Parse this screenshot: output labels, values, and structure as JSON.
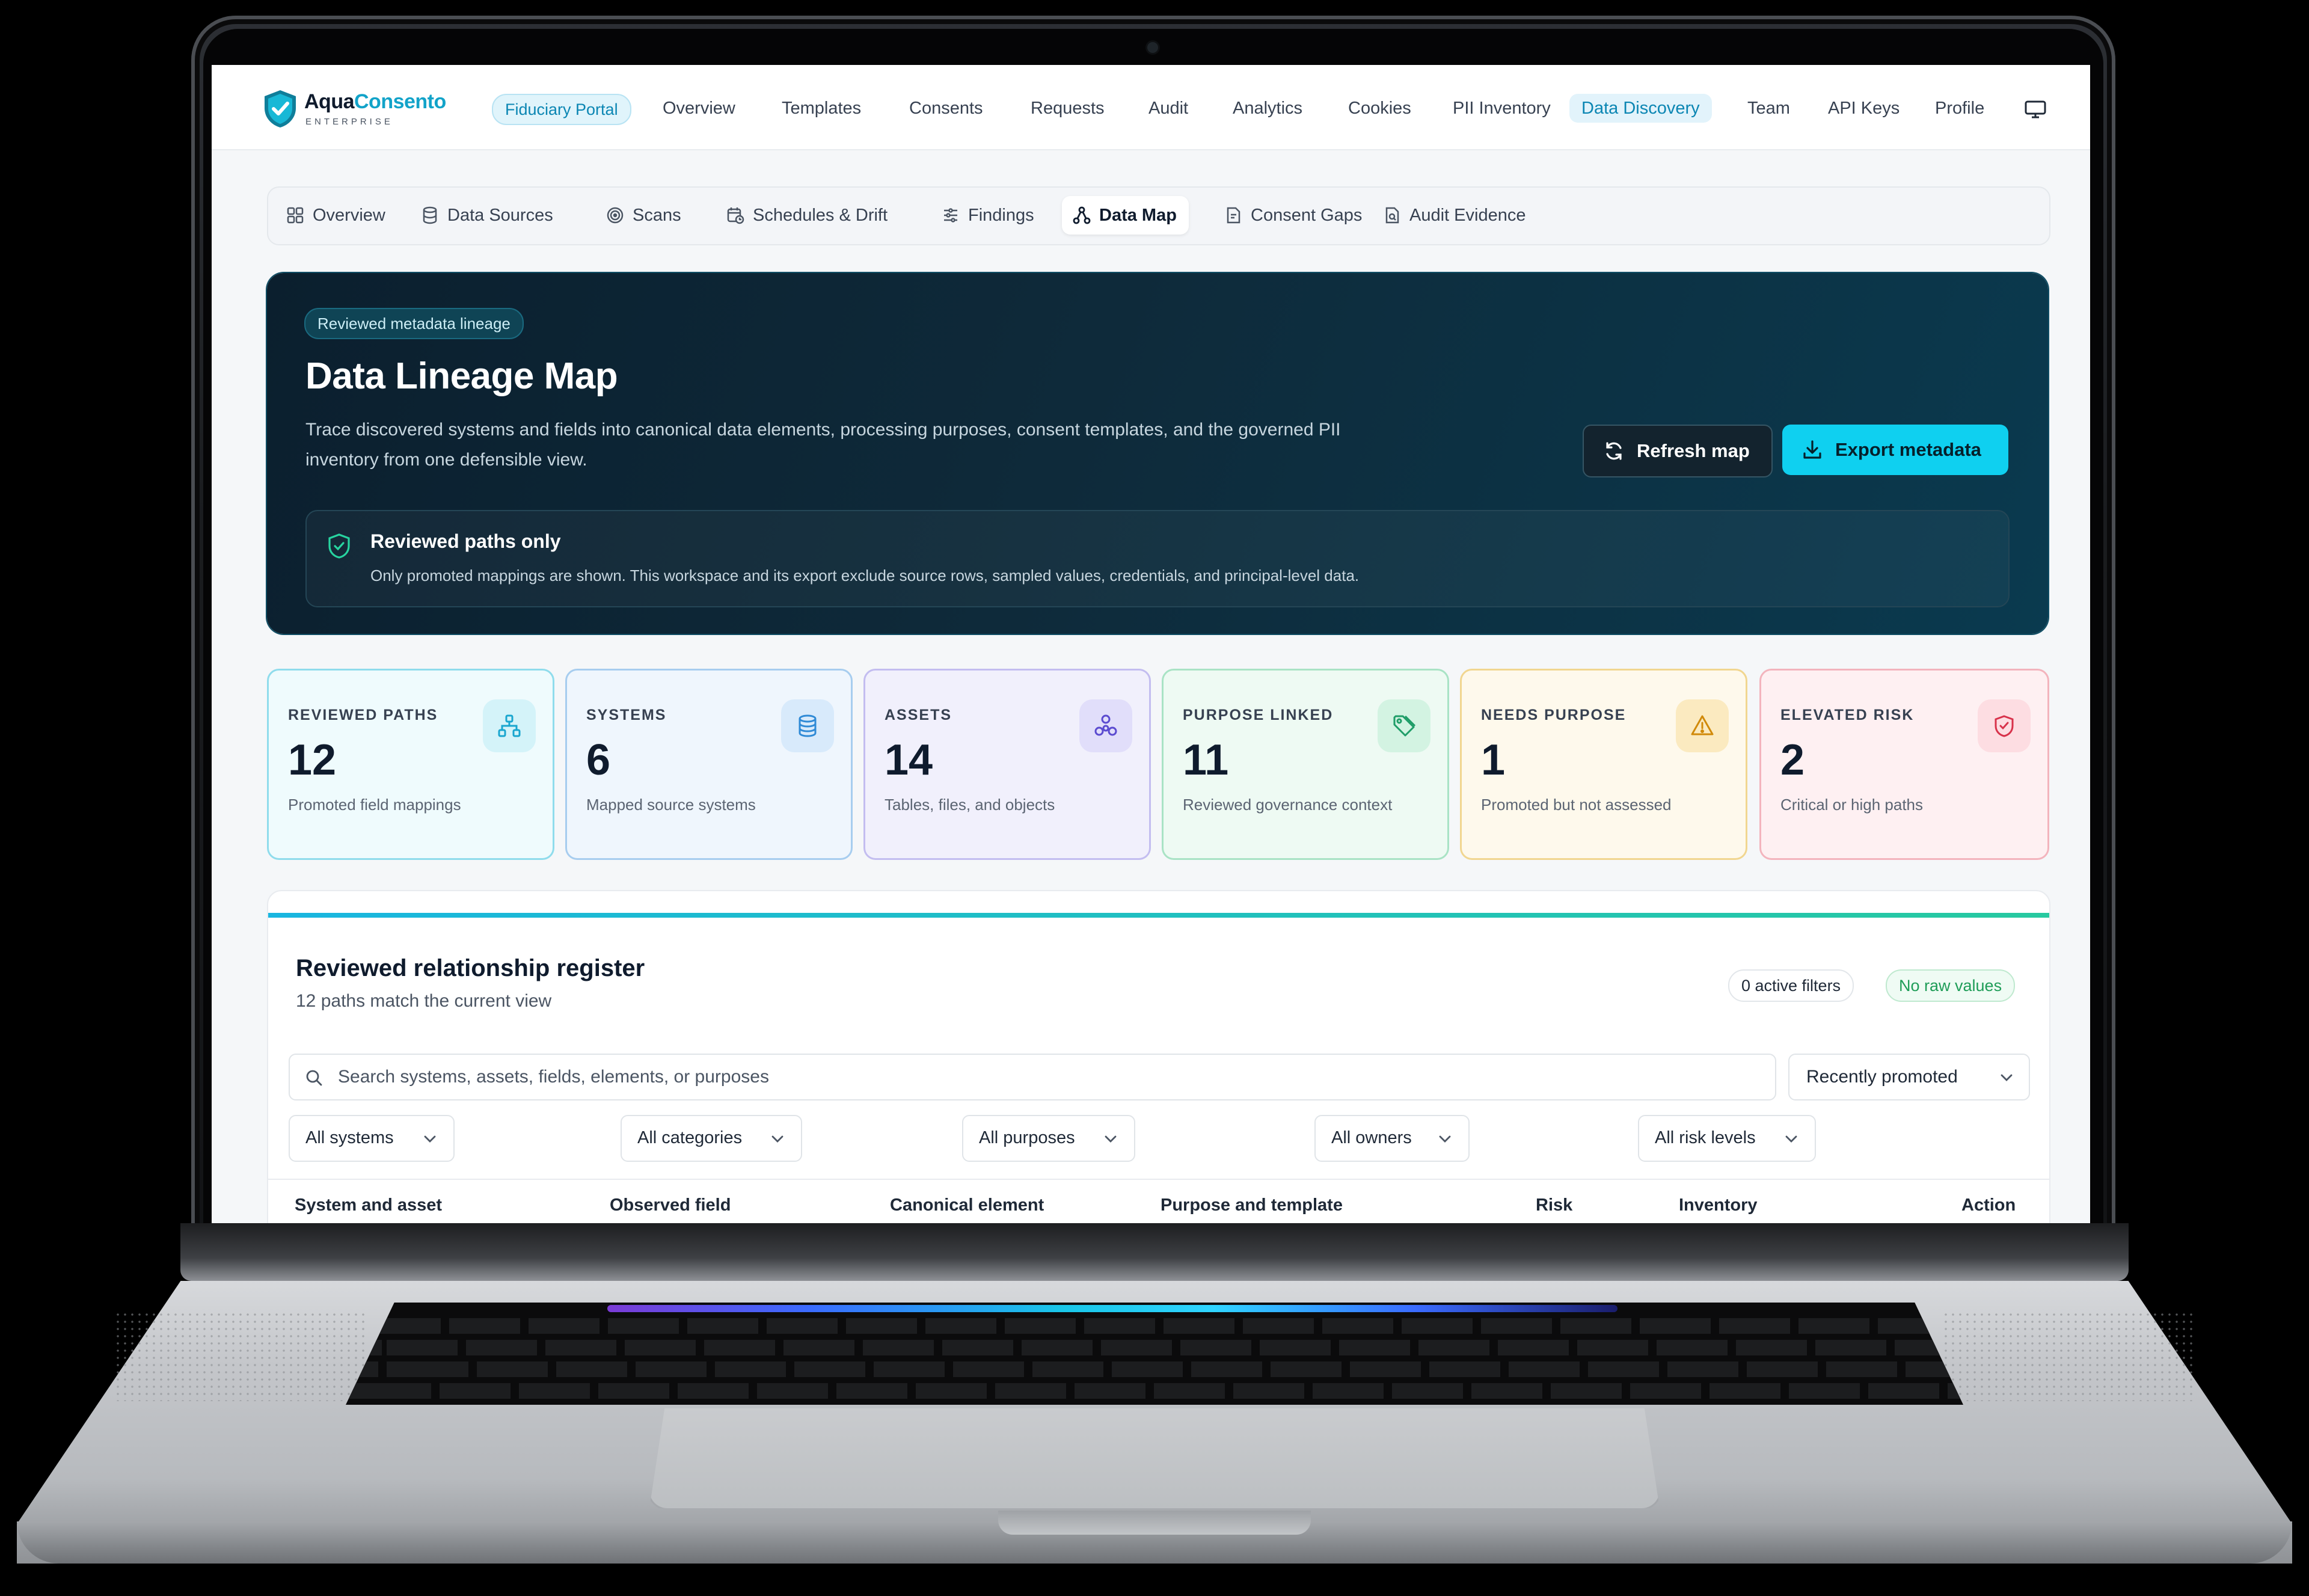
{
  "brand": {
    "name_a": "Aqua",
    "name_b": "Consento",
    "tagline": "ENTERPRISE"
  },
  "topnav": {
    "portal": "Fiduciary Portal",
    "items": [
      "Overview",
      "Templates",
      "Consents",
      "Requests",
      "Audit",
      "Analytics",
      "Cookies",
      "PII Inventory",
      "Data Discovery",
      "Team",
      "API Keys",
      "Profile"
    ],
    "active": "Data Discovery"
  },
  "subnav": {
    "items": [
      "Overview",
      "Data Sources",
      "Scans",
      "Schedules & Drift",
      "Findings",
      "Data Map",
      "Consent Gaps",
      "Audit Evidence"
    ],
    "active": "Data Map"
  },
  "hero": {
    "badge": "Reviewed metadata lineage",
    "title": "Data Lineage Map",
    "description": "Trace discovered systems and fields into canonical data elements, processing purposes, consent templates, and the governed PII inventory from one defensible view.",
    "refresh_label": "Refresh map",
    "export_label": "Export metadata",
    "notice_title": "Reviewed paths only",
    "notice_text": "Only promoted mappings are shown. This workspace and its export exclude source rows, sampled values, credentials, and principal-level data."
  },
  "stats": [
    {
      "label": "REVIEWED PATHS",
      "value": "12",
      "sub": "Promoted field mappings",
      "icon": "hierarchy-icon",
      "color": "#19b6e0"
    },
    {
      "label": "SYSTEMS",
      "value": "6",
      "sub": "Mapped source systems",
      "icon": "database-icon",
      "color": "#3b9ae0"
    },
    {
      "label": "ASSETS",
      "value": "14",
      "sub": "Tables, files, and objects",
      "icon": "cluster-icon",
      "color": "#6b5bd6"
    },
    {
      "label": "PURPOSE LINKED",
      "value": "11",
      "sub": "Reviewed governance context",
      "icon": "tag-icon",
      "color": "#27b87a"
    },
    {
      "label": "NEEDS PURPOSE",
      "value": "1",
      "sub": "Promoted but not assessed",
      "icon": "warning-icon",
      "color": "#e0a01a"
    },
    {
      "label": "ELEVATED RISK",
      "value": "2",
      "sub": "Critical or high paths",
      "icon": "shield-alert-icon",
      "color": "#e0455c"
    }
  ],
  "register": {
    "title": "Reviewed relationship register",
    "subtitle": "12 paths match the current view",
    "active_filters": "0 active filters",
    "no_raw": "No raw values",
    "search_placeholder": "Search systems, assets, fields, elements, or purposes",
    "sort": "Recently promoted",
    "filters": [
      "All systems",
      "All categories",
      "All purposes",
      "All owners",
      "All risk levels"
    ],
    "columns": [
      "System and asset",
      "Observed field",
      "Canonical element",
      "Purpose and template",
      "Risk",
      "Inventory",
      "Action"
    ]
  }
}
